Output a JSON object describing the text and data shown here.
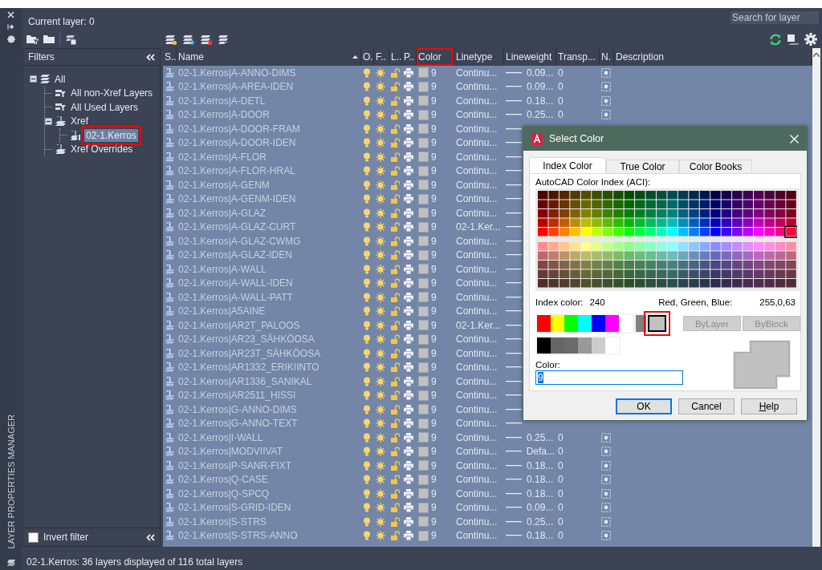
{
  "panel_title": "LAYER PROPERTIES MANAGER",
  "current_layer": "Current layer: 0",
  "search": {
    "placeholder": "Search for layer"
  },
  "filters": {
    "title": "Filters",
    "tree": [
      {
        "label": "All",
        "kind": "all",
        "expanded": true,
        "selected": false,
        "highlighted": false,
        "children": [
          {
            "label": "All non-Xref Layers",
            "kind": "property",
            "selected": false,
            "highlighted": false
          },
          {
            "label": "All Used Layers",
            "kind": "property",
            "selected": false,
            "highlighted": false
          },
          {
            "label": "Xref",
            "kind": "xref",
            "expanded": true,
            "selected": false,
            "highlighted": false,
            "children": [
              {
                "label": "02-1.Kerros",
                "kind": "xref-file",
                "selected": true,
                "highlighted": true
              }
            ]
          },
          {
            "label": "Xref Overrides",
            "kind": "xref",
            "selected": false,
            "highlighted": false
          }
        ]
      }
    ],
    "invert_filter": {
      "label": "Invert filter",
      "checked": false
    }
  },
  "table": {
    "columns": [
      {
        "label": "S..",
        "sorted": false,
        "highlighted": false
      },
      {
        "label": "Name",
        "sorted": true,
        "highlighted": false
      },
      {
        "label": "O.",
        "sorted": false,
        "highlighted": false
      },
      {
        "label": "F..",
        "sorted": false,
        "highlighted": false
      },
      {
        "label": "L..",
        "sorted": false,
        "highlighted": false
      },
      {
        "label": "P..",
        "sorted": false,
        "highlighted": false
      },
      {
        "label": "Color",
        "sorted": false,
        "highlighted": true
      },
      {
        "label": "Linetype",
        "sorted": false,
        "highlighted": false
      },
      {
        "label": "Lineweight",
        "sorted": false,
        "highlighted": false
      },
      {
        "label": "Transp...",
        "sorted": false,
        "highlighted": false
      },
      {
        "label": "N.",
        "sorted": false,
        "highlighted": false
      },
      {
        "label": "Description",
        "sorted": false,
        "highlighted": false
      }
    ],
    "rows": [
      {
        "name": "02-1.Kerros|A-ANNO-DIMS",
        "on": true,
        "frozen": false,
        "locked": false,
        "plot": true,
        "color_index": "9",
        "linetype": "Continu...",
        "lineweight": "0.09...",
        "transparency": "0"
      },
      {
        "name": "02-1.Kerros|A-AREA-IDEN",
        "on": true,
        "frozen": false,
        "locked": false,
        "plot": true,
        "color_index": "9",
        "linetype": "Continu...",
        "lineweight": "0.09...",
        "transparency": "0"
      },
      {
        "name": "02-1.Kerros|A-DETL",
        "on": true,
        "frozen": false,
        "locked": false,
        "plot": true,
        "color_index": "9",
        "linetype": "Continu...",
        "lineweight": "0.18...",
        "transparency": "0"
      },
      {
        "name": "02-1.Kerros|A-DOOR",
        "on": true,
        "frozen": false,
        "locked": false,
        "plot": true,
        "color_index": "9",
        "linetype": "Continu...",
        "lineweight": "0.25...",
        "transparency": "0"
      },
      {
        "name": "02-1.Kerros|A-DOOR-FRAM",
        "on": true,
        "frozen": false,
        "locked": false,
        "plot": true,
        "color_index": "9",
        "linetype": "Continu..."
      },
      {
        "name": "02-1.Kerros|A-DOOR-IDEN",
        "on": true,
        "frozen": false,
        "locked": false,
        "plot": true,
        "color_index": "9",
        "linetype": "Continu..."
      },
      {
        "name": "02-1.Kerros|A-FLOR",
        "on": true,
        "frozen": false,
        "locked": false,
        "plot": true,
        "color_index": "9",
        "linetype": "Continu..."
      },
      {
        "name": "02-1.Kerros|A-FLOR-HRAL",
        "on": true,
        "frozen": false,
        "locked": false,
        "plot": true,
        "color_index": "9",
        "linetype": "Continu..."
      },
      {
        "name": "02-1.Kerros|A-GENM",
        "on": true,
        "frozen": false,
        "locked": false,
        "plot": true,
        "color_index": "9",
        "linetype": "Continu..."
      },
      {
        "name": "02-1.Kerros|A-GENM-IDEN",
        "on": true,
        "frozen": false,
        "locked": false,
        "plot": true,
        "color_index": "9",
        "linetype": "Continu..."
      },
      {
        "name": "02-1.Kerros|A-GLAZ",
        "on": true,
        "frozen": false,
        "locked": false,
        "plot": true,
        "color_index": "9",
        "linetype": "Continu..."
      },
      {
        "name": "02-1.Kerros|A-GLAZ-CURT",
        "on": true,
        "frozen": false,
        "locked": false,
        "plot": true,
        "color_index": "9",
        "linetype": "02-1.Ker..."
      },
      {
        "name": "02-1.Kerros|A-GLAZ-CWMG",
        "on": true,
        "frozen": false,
        "locked": false,
        "plot": true,
        "color_index": "9",
        "linetype": "Continu..."
      },
      {
        "name": "02-1.Kerros|A-GLAZ-IDEN",
        "on": true,
        "frozen": false,
        "locked": false,
        "plot": true,
        "color_index": "9",
        "linetype": "Continu..."
      },
      {
        "name": "02-1.Kerros|A-WALL",
        "on": true,
        "frozen": false,
        "locked": false,
        "plot": true,
        "color_index": "9",
        "linetype": "Continu..."
      },
      {
        "name": "02-1.Kerros|A-WALL-IDEN",
        "on": true,
        "frozen": false,
        "locked": false,
        "plot": true,
        "color_index": "9",
        "linetype": "Continu..."
      },
      {
        "name": "02-1.Kerros|A-WALL-PATT",
        "on": true,
        "frozen": false,
        "locked": false,
        "plot": true,
        "color_index": "9",
        "linetype": "Continu..."
      },
      {
        "name": "02-1.Kerros|A5AINE",
        "on": true,
        "frozen": false,
        "locked": false,
        "plot": true,
        "color_index": "9",
        "linetype": "Continu..."
      },
      {
        "name": "02-1.Kerros|AR2T_PALOOS",
        "on": true,
        "frozen": false,
        "locked": false,
        "plot": true,
        "color_index": "9",
        "linetype": "02-1.Ker..."
      },
      {
        "name": "02-1.Kerros|AR23_SÄHKÖOSA",
        "on": true,
        "frozen": false,
        "locked": false,
        "plot": true,
        "color_index": "9",
        "linetype": "Continu..."
      },
      {
        "name": "02-1.Kerros|AR23T_SÄHKÖOSA",
        "on": true,
        "frozen": false,
        "locked": false,
        "plot": true,
        "color_index": "9",
        "linetype": "Continu..."
      },
      {
        "name": "02-1.Kerros|AR1332_ERIKIINTO",
        "on": true,
        "frozen": false,
        "locked": false,
        "plot": true,
        "color_index": "9",
        "linetype": "Continu..."
      },
      {
        "name": "02-1.Kerros|AR1336_SANIKAL",
        "on": true,
        "frozen": false,
        "locked": false,
        "plot": true,
        "color_index": "9",
        "linetype": "Continu..."
      },
      {
        "name": "02-1.Kerros|AR2511_HISSI",
        "on": true,
        "frozen": false,
        "locked": false,
        "plot": true,
        "color_index": "9",
        "linetype": "Continu..."
      },
      {
        "name": "02-1.Kerros|G-ANNO-DIMS",
        "on": true,
        "frozen": false,
        "locked": false,
        "plot": true,
        "color_index": "9",
        "linetype": "Continu..."
      },
      {
        "name": "02-1.Kerros|G-ANNO-TEXT",
        "on": true,
        "frozen": false,
        "locked": false,
        "plot": true,
        "color_index": "9",
        "linetype": "Continu..."
      },
      {
        "name": "02-1.Kerros|I-WALL",
        "on": true,
        "frozen": false,
        "locked": false,
        "plot": true,
        "color_index": "9",
        "linetype": "Continu...",
        "lineweight": "0.25...",
        "transparency": "0"
      },
      {
        "name": "02-1.Kerros|MODVIIVAT",
        "on": true,
        "frozen": false,
        "locked": false,
        "plot": true,
        "color_index": "9",
        "linetype": "Continu...",
        "lineweight": "Defa...",
        "transparency": "0"
      },
      {
        "name": "02-1.Kerros|P-SANR-FIXT",
        "on": true,
        "frozen": false,
        "locked": false,
        "plot": true,
        "color_index": "9",
        "linetype": "Continu...",
        "lineweight": "0.18...",
        "transparency": "0"
      },
      {
        "name": "02-1.Kerros|Q-CASE",
        "on": true,
        "frozen": false,
        "locked": false,
        "plot": true,
        "color_index": "9",
        "linetype": "Continu...",
        "lineweight": "0.18...",
        "transparency": "0"
      },
      {
        "name": "02-1.Kerros|Q-SPCQ",
        "on": true,
        "frozen": false,
        "locked": false,
        "plot": true,
        "color_index": "9",
        "linetype": "Continu...",
        "lineweight": "0.18...",
        "transparency": "0"
      },
      {
        "name": "02-1.Kerros|S-GRID-IDEN",
        "on": true,
        "frozen": false,
        "locked": false,
        "plot": true,
        "color_index": "9",
        "linetype": "Continu...",
        "lineweight": "0.09...",
        "transparency": "0"
      },
      {
        "name": "02-1.Kerros|S-STRS",
        "on": true,
        "frozen": false,
        "locked": false,
        "plot": true,
        "color_index": "9",
        "linetype": "Continu...",
        "lineweight": "0.25...",
        "transparency": "0"
      },
      {
        "name": "02-1.Kerros|S-STRS-ANNO",
        "on": true,
        "frozen": false,
        "locked": false,
        "plot": true,
        "color_index": "9",
        "linetype": "Continu...",
        "lineweight": "0.18...",
        "transparency": "0"
      }
    ]
  },
  "status_bar": "02-1.Kerros: 36 layers displayed of 116 total layers",
  "dialog": {
    "title": "Select Color",
    "tabs": [
      {
        "label": "Index Color",
        "selected": true
      },
      {
        "label": "True Color",
        "selected": false
      },
      {
        "label": "Color Books",
        "selected": false
      }
    ],
    "palette_label": "AutoCAD Color Index (ACI):",
    "index_label": "Index color:",
    "index_value": "240",
    "rgb_label": "Red, Green, Blue:",
    "rgb_value": "255,0,63",
    "standard_colors": [
      {
        "color": "#ff0000",
        "selected": false,
        "highlighted": false
      },
      {
        "color": "#ffff00",
        "selected": false,
        "highlighted": false
      },
      {
        "color": "#00ff00",
        "selected": false,
        "highlighted": false
      },
      {
        "color": "#00ffff",
        "selected": false,
        "highlighted": false
      },
      {
        "color": "#0000ff",
        "selected": false,
        "highlighted": false
      },
      {
        "color": "#ff00ff",
        "selected": false,
        "highlighted": false
      },
      {
        "color": "#ffffff",
        "selected": false,
        "highlighted": false
      },
      {
        "color": "#808080",
        "selected": false,
        "highlighted": false
      },
      {
        "color": "#c0c0c0",
        "selected": true,
        "highlighted": true
      }
    ],
    "gray_colors": [
      {
        "color": "#000000",
        "selected": false
      },
      {
        "color": "#656565",
        "selected": false
      },
      {
        "color": "#6b6b6b",
        "selected": false
      },
      {
        "color": "#999999",
        "selected": false
      },
      {
        "color": "#cccccc",
        "selected": false
      },
      {
        "color": "#ffffff",
        "selected": false
      }
    ],
    "special_buttons": [
      {
        "label": "ByLayer",
        "disabled": true
      },
      {
        "label": "ByBlock",
        "disabled": true
      }
    ],
    "color_field": {
      "label": "Color:",
      "value": "9"
    },
    "buttons": [
      {
        "label": "OK",
        "default": true
      },
      {
        "label": "Cancel",
        "default": false
      },
      {
        "label": "Help",
        "default": false
      }
    ]
  }
}
